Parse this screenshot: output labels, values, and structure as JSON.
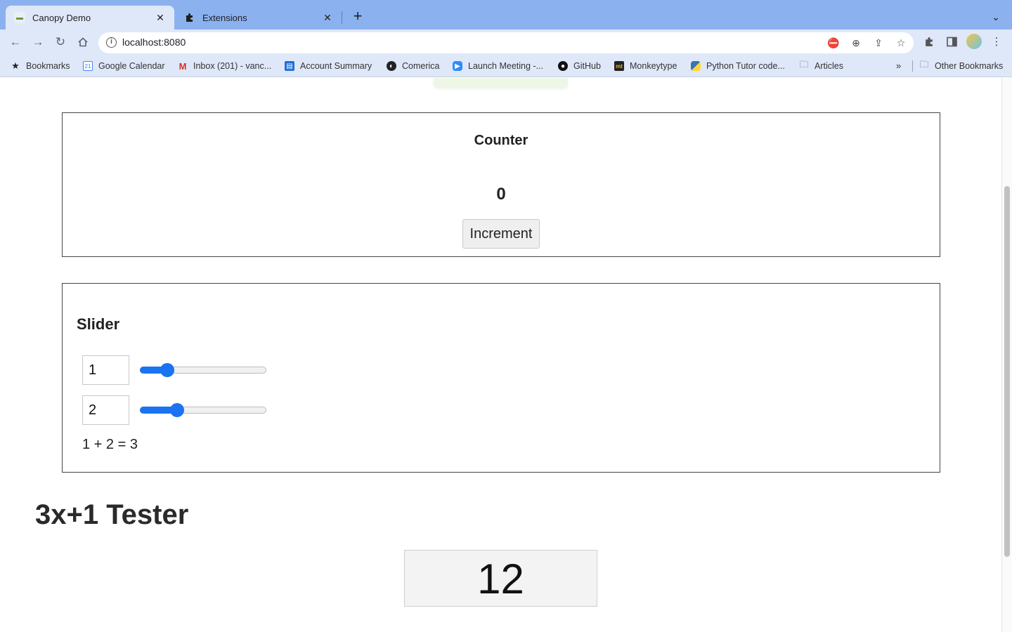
{
  "browser": {
    "tabs": [
      {
        "title": "Canopy Demo",
        "active": true,
        "icon": "canopy-favicon"
      },
      {
        "title": "Extensions",
        "active": false,
        "icon": "puzzle-icon"
      }
    ],
    "close_glyph": "✕",
    "new_tab_glyph": "+",
    "tab_menu_glyph": "⌄",
    "url": "localhost:8080",
    "info_glyph": "i",
    "bookmarks": [
      {
        "label": "Bookmarks",
        "icon": "star-icon"
      },
      {
        "label": "Google Calendar",
        "icon": "calendar-icon"
      },
      {
        "label": "Inbox (201) - vanc...",
        "icon": "gmail-icon"
      },
      {
        "label": "Account Summary",
        "icon": "bank-icon"
      },
      {
        "label": "Comerica",
        "icon": "comerica-icon"
      },
      {
        "label": "Launch Meeting -...",
        "icon": "zoom-icon"
      },
      {
        "label": "GitHub",
        "icon": "github-icon"
      },
      {
        "label": "Monkeytype",
        "icon": "monkeytype-icon"
      },
      {
        "label": "Python Tutor code...",
        "icon": "python-icon"
      },
      {
        "label": "Articles",
        "icon": "folder-icon"
      }
    ],
    "bookmarks_overflow": "»",
    "other_bookmarks": "Other Bookmarks",
    "colors": {
      "tabstrip": "#8bb1ef",
      "toolbar": "#dfe8f9",
      "accent": "#1a73f0"
    }
  },
  "counter": {
    "title": "Counter",
    "value": "0",
    "button_label": "Increment"
  },
  "slider": {
    "title": "Slider",
    "a": {
      "value": "1",
      "fraction": 0.18
    },
    "b": {
      "value": "2",
      "fraction": 0.27
    },
    "sum_text": "1 + 2 = 3"
  },
  "tester": {
    "title": "3x+1 Tester",
    "value": "12"
  }
}
